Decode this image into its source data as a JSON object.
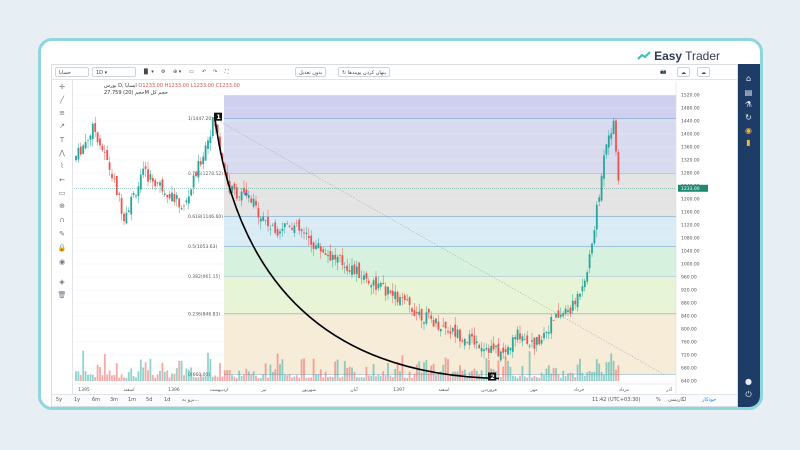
{
  "brand": {
    "word1": "Easy",
    "word2": "Trader"
  },
  "toolbar": {
    "symbol": "خسایا",
    "interval": "1D",
    "indicators_label": "",
    "compare_label": "بدون تعدیل",
    "status_label": "پنهان کردن پویندها",
    "camera": "camera-icon",
    "cloud": "cloud-icon",
    "cloud2": "cloud-upload-icon"
  },
  "legend": {
    "title": "بورس D, ایسایا",
    "ohlc": "O1233.00 H1233.00 L1233.00 C1233.00",
    "volume": "حجم (20)  27.759M",
    "volume_label": "حجم کل"
  },
  "chart_data": {
    "type": "candlestick",
    "fib_levels": [
      {
        "ratio": "1",
        "label": "1(1447.20)",
        "value": 1447.2,
        "color": "#d8dbef"
      },
      {
        "ratio": "0.786",
        "label": "0.786(1278.52)",
        "value": 1278.52,
        "color": "#e4e4e4"
      },
      {
        "ratio": "0.618",
        "label": "0.618(1146.60)",
        "value": 1146.6,
        "color": "#d9ecf6"
      },
      {
        "ratio": "0.5",
        "label": "0.5(1053.63)",
        "value": 1053.63,
        "color": "#d6f1de"
      },
      {
        "ratio": "0.382",
        "label": "0.382(961.15)",
        "value": 961.15,
        "color": "#e8f4d6"
      },
      {
        "ratio": "0.236",
        "label": "0.236(846.83)",
        "value": 846.83,
        "color": "#f6ecd8"
      },
      {
        "ratio": "0",
        "label": "0(660.00)",
        "value": 660.0,
        "color": "#f8dede"
      }
    ],
    "top_band_color": "#cfd0f0",
    "price_axis": [
      "1520.00",
      "1480.00",
      "1440.00",
      "1400.00",
      "1360.00",
      "1320.00",
      "1280.00",
      "1240.00",
      "1200.00",
      "1160.00",
      "1120.00",
      "1080.00",
      "1040.00",
      "1000.00",
      "960.00",
      "920.00",
      "880.00",
      "840.00",
      "800.00",
      "760.00",
      "720.00",
      "680.00",
      "640.00"
    ],
    "current_price": "1233.00",
    "time_axis": [
      "1395",
      "اسفند",
      "1396",
      "اردیبهشت",
      "تیر",
      "شهریور",
      "آبان",
      "1397",
      "اسفند",
      "فروردین",
      "مهر",
      "خرداد",
      "مرداد",
      "آذر"
    ],
    "markers": [
      "1",
      "2"
    ],
    "up_color": "#26a69a",
    "down_color": "#ef5350"
  },
  "bottombar": {
    "ranges": [
      "5y",
      "1y",
      "6m",
      "3m",
      "1m",
      "5d",
      "1d"
    ],
    "goto": "برو به...",
    "time": "11:42 (UTC+03:30)",
    "percent": "%",
    "log": "لگاریتمی",
    "auto": "خودکار"
  },
  "icons": {
    "crosshair": "crosshair-icon",
    "trendline": "trendline-icon",
    "fib": "fibonacci-icon",
    "brush": "brush-icon",
    "text": "text-icon",
    "pattern": "pattern-icon",
    "measure": "measure-icon",
    "zoom": "zoom-icon",
    "magnet": "magnet-icon",
    "lock": "lock-icon",
    "eye": "eye-icon",
    "trash": "trash-icon"
  },
  "sidebar_icons": [
    "home-icon",
    "book-icon",
    "flask-icon",
    "refresh-icon",
    "eye-icon",
    "chart-icon",
    "chat-icon",
    "power-icon"
  ]
}
